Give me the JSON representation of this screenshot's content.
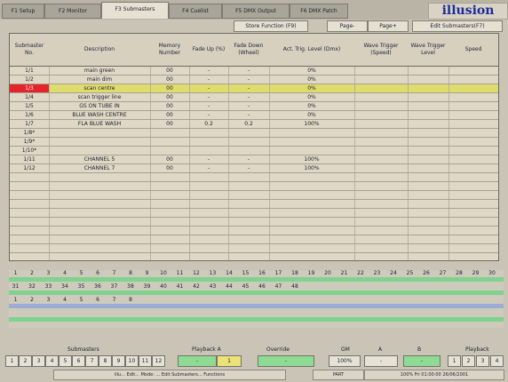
{
  "tabs": [
    {
      "label": "F1 Setup"
    },
    {
      "label": "F2 Monitor"
    },
    {
      "label": "F3 Submasters"
    },
    {
      "label": "F4 Cuelist"
    },
    {
      "label": "F5 DMX Output"
    },
    {
      "label": "F6 DMX Patch"
    }
  ],
  "logo": "illusion",
  "function_buttons": [
    {
      "label": "Store Function (F9)"
    },
    {
      "label": "Page-"
    },
    {
      "label": "Page+"
    },
    {
      "label": "Edit Submasters(F7)"
    }
  ],
  "table": {
    "headers": [
      "Submaster No.",
      "Description",
      "Memory Number",
      "Fade Up (%)",
      "Fade Down (Wheel)",
      "Act. Trig. Level (Dmx)",
      "Wave Trigger (Speed)",
      "Wave Trigger Level",
      "Speed"
    ],
    "rows": [
      [
        "1/1",
        "main green",
        "00",
        "-",
        "-",
        "0%",
        "",
        "",
        ""
      ],
      [
        "1/2",
        "main dim",
        "00",
        "-",
        "-",
        "0%",
        "",
        "",
        ""
      ],
      [
        "1/3",
        "scan centre",
        "00",
        "-",
        "-",
        "0%",
        "",
        "",
        ""
      ],
      [
        "1/4",
        "scan trigger line",
        "00",
        "-",
        "-",
        "0%",
        "",
        "",
        ""
      ],
      [
        "1/5",
        "GS ON TUBE IN",
        "00",
        "-",
        "-",
        "0%",
        "",
        "",
        ""
      ],
      [
        "1/6",
        "BLUE WASH CENTRE",
        "00",
        "-",
        "-",
        "0%",
        "",
        "",
        ""
      ],
      [
        "1/7",
        "FLA BLUE WASH",
        "00",
        "0.2",
        "0.2",
        "100%",
        "",
        "",
        ""
      ],
      [
        "1/8*",
        "",
        "",
        "",
        "",
        "",
        "",
        "",
        ""
      ],
      [
        "1/9*",
        "",
        "",
        "",
        "",
        "",
        "",
        "",
        ""
      ],
      [
        "1/10*",
        "",
        "",
        "",
        "",
        "",
        "",
        "",
        ""
      ],
      [
        "1/11",
        "CHANNEL 5",
        "00",
        "-",
        "-",
        "100%",
        "",
        "",
        ""
      ],
      [
        "1/12",
        "CHANNEL 7",
        "00",
        "-",
        "-",
        "100%",
        "",
        "",
        ""
      ],
      [
        "",
        "",
        "",
        "",
        "",
        "",
        "",
        "",
        ""
      ],
      [
        "",
        "",
        "",
        "",
        "",
        "",
        "",
        "",
        ""
      ],
      [
        "",
        "",
        "",
        "",
        "",
        "",
        "",
        "",
        ""
      ],
      [
        "",
        "",
        "",
        "",
        "",
        "",
        "",
        "",
        ""
      ],
      [
        "",
        "",
        "",
        "",
        "",
        "",
        "",
        "",
        ""
      ],
      [
        "",
        "",
        "",
        "",
        "",
        "",
        "",
        "",
        ""
      ],
      [
        "",
        "",
        "",
        "",
        "",
        "",
        "",
        "",
        ""
      ],
      [
        "",
        "",
        "",
        "",
        "",
        "",
        "",
        "",
        ""
      ],
      [
        "",
        "",
        "",
        "",
        "",
        "",
        "",
        "",
        ""
      ],
      [
        "",
        "",
        "",
        "",
        "",
        "",
        "",
        "",
        ""
      ]
    ]
  },
  "channel_grid": {
    "row1": [
      "1",
      "2",
      "3",
      "4",
      "5",
      "6",
      "7",
      "8",
      "9",
      "10",
      "11",
      "12",
      "13",
      "14",
      "15",
      "16",
      "17",
      "18",
      "19",
      "20",
      "21",
      "22",
      "23",
      "24",
      "25",
      "26",
      "27",
      "28",
      "29",
      "30"
    ],
    "row2": [
      "31",
      "32",
      "33",
      "34",
      "35",
      "36",
      "37",
      "38",
      "39",
      "40",
      "41",
      "42",
      "43",
      "44",
      "45",
      "46",
      "47",
      "48"
    ],
    "row3": [
      "1",
      "2",
      "3",
      "4",
      "5",
      "6",
      "7",
      "8"
    ],
    "row4": []
  },
  "footer": {
    "submasters_label": "Submasters",
    "submaster_buttons": [
      "1",
      "2",
      "3",
      "4",
      "5",
      "6",
      "7",
      "8",
      "9",
      "10",
      "11",
      "12"
    ],
    "playback_label": "Playback A",
    "playback_values": [
      "-",
      "1"
    ],
    "override_label": "Override",
    "override_value": "-",
    "grand_master_label": "GM",
    "grand_master_value": "100%",
    "a_label": "A",
    "a_value": "-",
    "b_label": "B",
    "b_value": "-",
    "right_label": "Playback",
    "right_buttons": [
      "1",
      "2",
      "3",
      "4"
    ],
    "status_left": "illu... Edit... Mode: ... Edit Submasters... Functions",
    "status_mid": "PART",
    "status_right": "100%  Fri 01:00:00 26/06/2001"
  }
}
